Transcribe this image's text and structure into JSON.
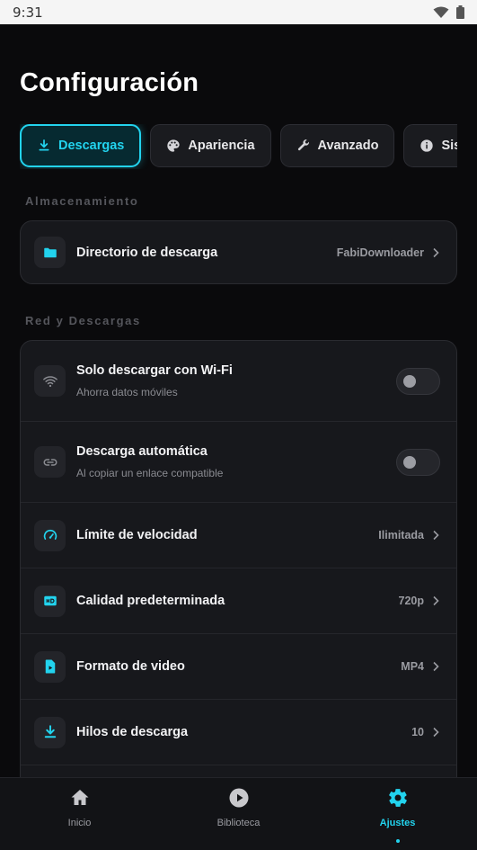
{
  "status_bar": {
    "time": "9:31"
  },
  "page": {
    "title": "Configuración"
  },
  "tabs": [
    {
      "label": "Descargas",
      "icon": "download-icon",
      "active": true
    },
    {
      "label": "Apariencia",
      "icon": "palette-icon",
      "active": false
    },
    {
      "label": "Avanzado",
      "icon": "wrench-icon",
      "active": false
    },
    {
      "label": "Sistema",
      "icon": "info-icon",
      "active": false
    }
  ],
  "sections": {
    "storage": {
      "label": "Almacenamiento",
      "rows": [
        {
          "title": "Directorio de descarga",
          "value": "FabiDownloader",
          "icon": "folder-icon"
        }
      ]
    },
    "network": {
      "label": "Red y Descargas",
      "rows": [
        {
          "title": "Solo descargar con Wi-Fi",
          "subtitle": "Ahorra datos móviles",
          "icon": "wifi-icon",
          "toggle": false
        },
        {
          "title": "Descarga automática",
          "subtitle": "Al copiar un enlace compatible",
          "icon": "link-icon",
          "toggle": false
        },
        {
          "title": "Límite de velocidad",
          "value": "Ilimitada",
          "icon": "speedometer-icon"
        },
        {
          "title": "Calidad predeterminada",
          "value": "720p",
          "icon": "hd-icon"
        },
        {
          "title": "Formato de video",
          "value": "MP4",
          "icon": "file-video-icon"
        },
        {
          "title": "Hilos de descarga",
          "value": "10",
          "icon": "download-icon"
        }
      ]
    }
  },
  "bottom_nav": [
    {
      "label": "Inicio",
      "icon": "home-icon",
      "active": false
    },
    {
      "label": "Biblioteca",
      "icon": "play-circle-icon",
      "active": false
    },
    {
      "label": "Ajustes",
      "icon": "gear-icon",
      "active": true
    }
  ],
  "colors": {
    "accent": "#22d3ee",
    "background": "#0a0a0c",
    "card": "#17181c"
  }
}
